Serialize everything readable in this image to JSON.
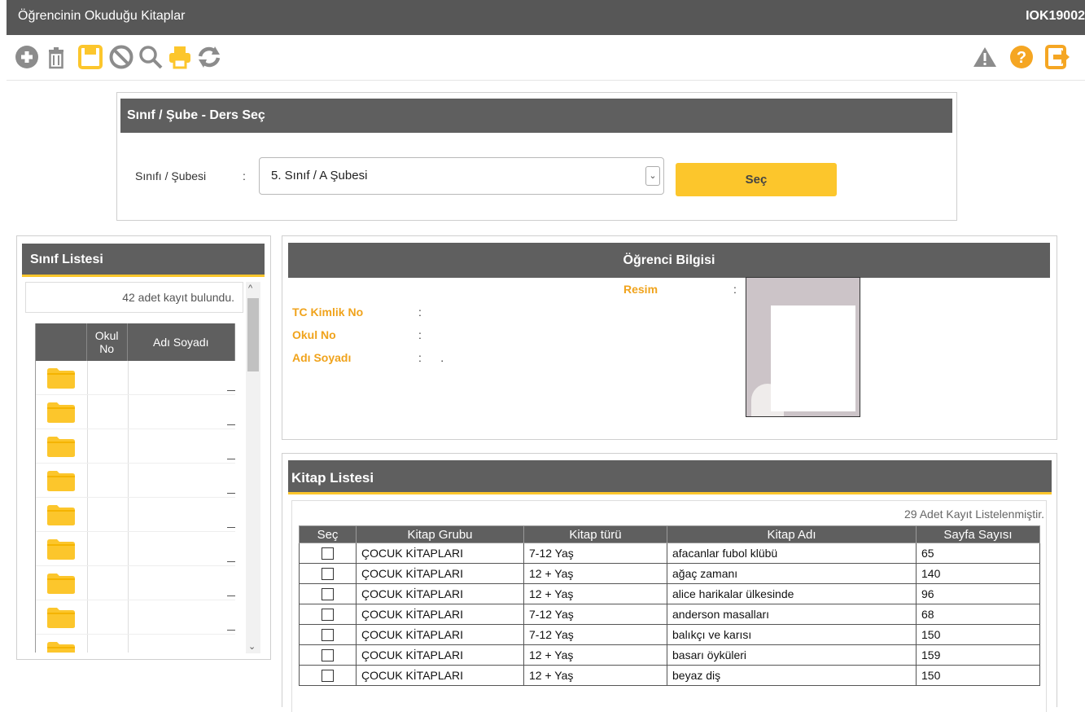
{
  "window": {
    "title": "Öğrencinin Okuduğu Kitaplar",
    "code": "IOK19002"
  },
  "toolbar": {
    "left_icons": [
      "add-icon",
      "trash-icon",
      "save-icon",
      "cancel-icon",
      "search-icon",
      "print-icon",
      "refresh-icon"
    ],
    "right_icons": [
      "warning-icon",
      "help-icon",
      "exit-icon"
    ],
    "accent": "#fcc62c",
    "icon_gray": "#8c8c8c"
  },
  "selection": {
    "header": "Sınıf / Şube  - Ders Seç",
    "label": "Sınıfı / Şubesi",
    "colon": ":",
    "selected": "5. Sınıf / A Şubesi",
    "button": "Seç"
  },
  "class_list": {
    "header": "Sınıf Listesi",
    "count_text": "42 adet kayıt bulundu.",
    "columns": [
      "",
      "Okul No",
      "Adı Soyadı"
    ],
    "rows": 9
  },
  "student": {
    "header": "Öğrenci Bilgisi",
    "photo_label": "Resim",
    "colon": ":",
    "fields": [
      {
        "label": "TC Kimlik No",
        "value": ":"
      },
      {
        "label": "Okul No",
        "value": ":"
      },
      {
        "label": "Adı Soyadı",
        "value": ":      ."
      }
    ]
  },
  "books": {
    "header": "Kitap Listesi",
    "count_text": "29 Adet Kayıt Listelenmiştir.",
    "columns": [
      "Seç",
      "Kitap Grubu",
      "Kitap türü",
      "Kitap Adı",
      "Sayfa Sayısı"
    ],
    "rows": [
      {
        "group": "ÇOCUK KİTAPLARI",
        "type": "7-12 Yaş",
        "name": "afacanlar fubol klübü",
        "pages": "65"
      },
      {
        "group": "ÇOCUK KİTAPLARI",
        "type": "12 + Yaş",
        "name": "ağaç zamanı",
        "pages": "140"
      },
      {
        "group": "ÇOCUK KİTAPLARI",
        "type": "12 + Yaş",
        "name": "alice harikalar ülkesinde",
        "pages": "96"
      },
      {
        "group": "ÇOCUK KİTAPLARI",
        "type": "7-12 Yaş",
        "name": "anderson masalları",
        "pages": "68"
      },
      {
        "group": "ÇOCUK KİTAPLARI",
        "type": "7-12 Yaş",
        "name": "balıkçı ve karısı",
        "pages": "150"
      },
      {
        "group": "ÇOCUK KİTAPLARI",
        "type": "12 + Yaş",
        "name": "basarı öyküleri",
        "pages": "159"
      },
      {
        "group": "ÇOCUK KİTAPLARI",
        "type": "12 + Yaş",
        "name": "beyaz diş",
        "pages": "150"
      }
    ]
  }
}
